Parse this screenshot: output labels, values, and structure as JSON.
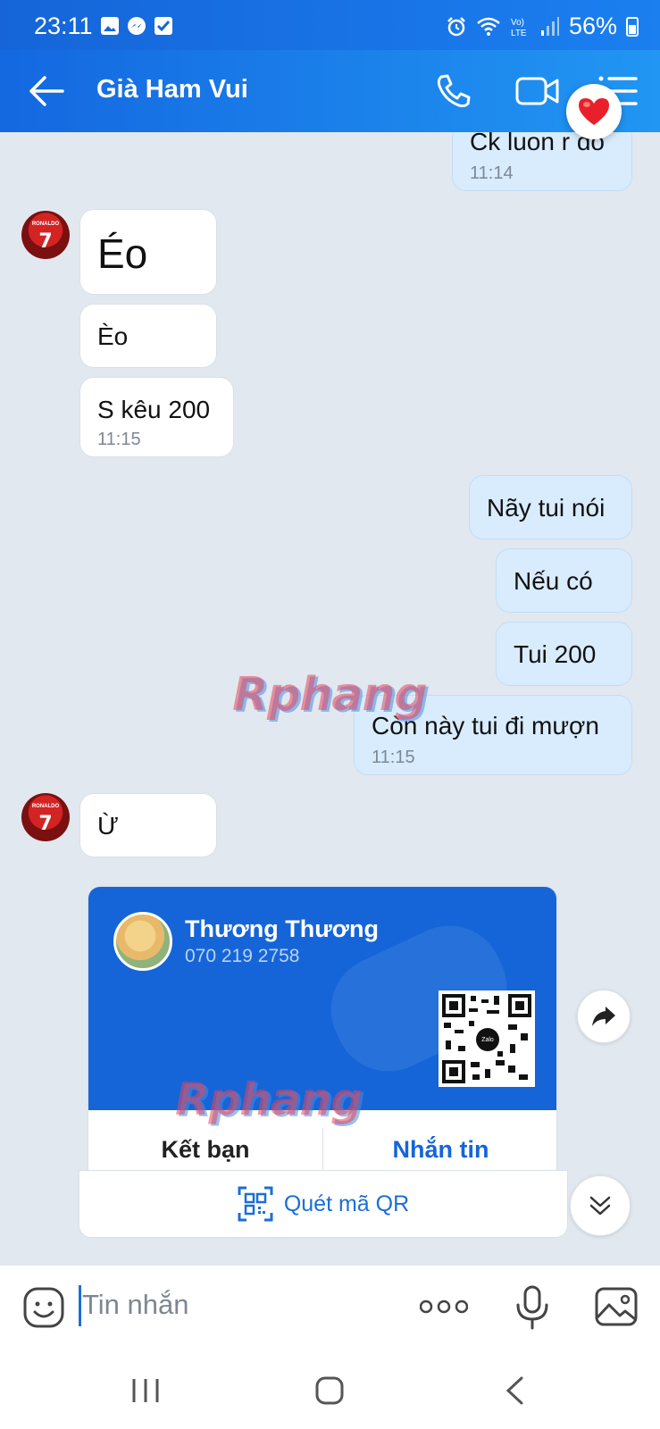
{
  "status_bar": {
    "time": "23:11",
    "battery": "56%"
  },
  "header": {
    "title": "Già Ham Vui"
  },
  "messages": [
    {
      "text": "Ck luon r đó",
      "time": "11:14"
    },
    {
      "text": "Éo"
    },
    {
      "text": "Èo"
    },
    {
      "text": "S kêu 200",
      "time": "11:15"
    },
    {
      "text": "Nãy tui nói"
    },
    {
      "text": "Nếu có"
    },
    {
      "text": "Tui 200"
    },
    {
      "text": "Còn này tui đi mượn",
      "time": "11:15"
    },
    {
      "text": "Ừ"
    }
  ],
  "contact_card": {
    "name": "Thương Thương",
    "phone": "070 219 2758",
    "qr_logo": "Zalo",
    "add_friend_label": "Kết bạn",
    "message_label": "Nhắn tin",
    "scan_label": "Quét mã QR"
  },
  "watermark": "Rphang",
  "input": {
    "placeholder": "Tin nhắn"
  },
  "icons": {
    "back": "back-arrow-icon",
    "call": "phone-icon",
    "video": "video-camera-icon",
    "menu": "list-menu-icon",
    "reaction": "heart-icon",
    "share": "share-arrow-icon",
    "scroll_down": "chevron-double-down-icon",
    "emoji": "emoji-icon",
    "more": "more-dots-icon",
    "mic": "microphone-icon",
    "image": "image-icon"
  },
  "colors": {
    "brand": "#1565d8",
    "sent_bubble": "#d8ecfd",
    "received_bubble": "#ffffff",
    "background": "#e2e8ef"
  }
}
